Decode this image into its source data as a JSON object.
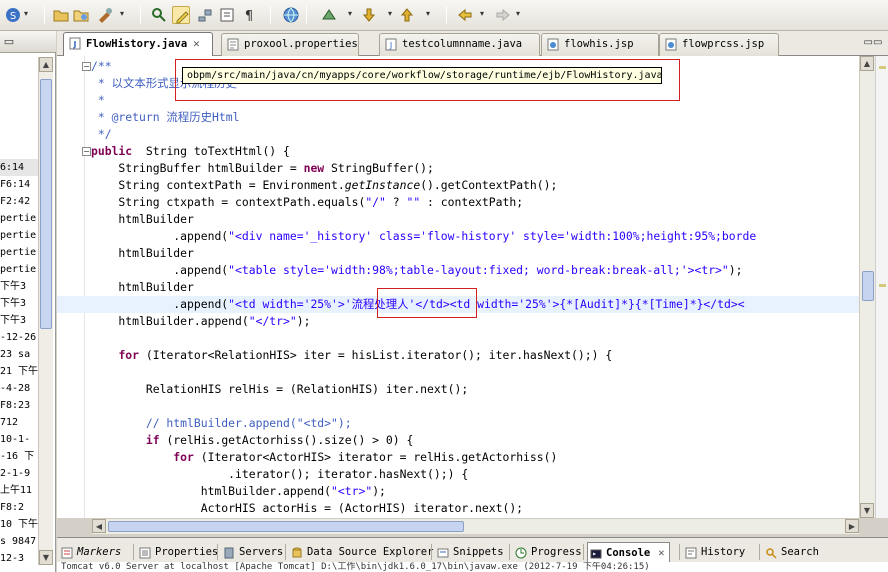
{
  "toolbar": {
    "icons": [
      "save-icon",
      "dropdown",
      "folder-open-icon",
      "open-type-icon",
      "build-icon",
      "dropdown",
      "toggle-mark-occurrences-icon",
      "highlight-icon",
      "link-icon",
      "block-selection-icon",
      "show-whitespace-icon",
      "globe-icon",
      "debug-icon",
      "dropdown",
      "next-annotation-icon",
      "dropdown",
      "prev-annotation-icon",
      "dropdown",
      "back-icon",
      "dropdown",
      "forward-icon",
      "dropdown"
    ]
  },
  "left": {
    "rows": [
      "6:14",
      "F6:14",
      "F2:42",
      "pertie",
      "pertie",
      "pertie",
      "pertie",
      "下午3",
      "下午3",
      "下午3",
      "-12-26",
      "23  sa",
      "21 下午",
      "-4-28",
      "F8:23",
      "712",
      "10-1-",
      "-16 下",
      "2-1-9",
      "上午11",
      "F8:2",
      "10 下午",
      "s 9847",
      "12-3"
    ]
  },
  "tabs": [
    {
      "label": "FlowHistory.java",
      "active": true,
      "icon": "java"
    },
    {
      "label": "proxool.properties",
      "active": false,
      "icon": "props"
    },
    {
      "label": "testcolumnname.java",
      "active": false,
      "icon": "java"
    },
    {
      "label": "flowhis.jsp",
      "active": false,
      "icon": "jsp"
    },
    {
      "label": "flowprcss.jsp",
      "active": false,
      "icon": "jsp"
    }
  ],
  "tooltip": "obpm/src/main/java/cn/myapps/core/workflow/storage/runtime/ejb/FlowHistory.java",
  "code": [
    [
      [
        "cm",
        "/**"
      ]
    ],
    [
      [
        "cm",
        " * 以文本形式显示流程历史"
      ]
    ],
    [
      [
        "cm",
        " *"
      ]
    ],
    [
      [
        "cm",
        " * @return 流程历史Html"
      ]
    ],
    [
      [
        "cm",
        " */"
      ]
    ],
    [
      [
        "kw",
        "public"
      ],
      [
        "",
        "  String toTextHtml() {"
      ]
    ],
    [
      [
        "",
        "    StringBuffer htmlBuilder = "
      ],
      [
        "kw",
        "new"
      ],
      [
        "",
        " StringBuffer();"
      ]
    ],
    [
      [
        "",
        "    String contextPath = Environment."
      ],
      [
        "it",
        "getInstance"
      ],
      [
        "",
        "().getContextPath();"
      ]
    ],
    [
      [
        "",
        "    String ctxpath = contextPath.equals("
      ],
      [
        "st",
        "\"/\""
      ],
      [
        "",
        " ? "
      ],
      [
        "st",
        "\"\""
      ],
      [
        "",
        " : contextPath;"
      ]
    ],
    [
      [
        "",
        "    htmlBuilder"
      ]
    ],
    [
      [
        "",
        "            .append("
      ],
      [
        "st",
        "\"<div name='_history' class='flow-history' style='width:100%;height:95%;borde"
      ]
    ],
    [
      [
        "",
        "    htmlBuilder"
      ]
    ],
    [
      [
        "",
        "            .append("
      ],
      [
        "st",
        "\"<table style='width:98%;table-layout:fixed; word-break:break-all;'><tr>\""
      ],
      [
        "",
        ");"
      ]
    ],
    [
      [
        "",
        "    htmlBuilder"
      ]
    ],
    [
      [
        "",
        "            .append("
      ],
      [
        "st",
        "\"<td width='25%'>'流程处理人'</td><td width='25%'>{*[Audit]*}{*[Time]*}</td><"
      ]
    ],
    [
      [
        "",
        "    htmlBuilder.append("
      ],
      [
        "st",
        "\"</tr>\""
      ],
      [
        "",
        ");"
      ]
    ],
    [
      [
        "",
        ""
      ]
    ],
    [
      [
        "",
        "    "
      ],
      [
        "kw",
        "for"
      ],
      [
        "",
        " (Iterator<RelationHIS> iter = hisList.iterator(); iter.hasNext();) {"
      ]
    ],
    [
      [
        "",
        ""
      ]
    ],
    [
      [
        "",
        "        RelationHIS relHis = (RelationHIS) iter.next();"
      ]
    ],
    [
      [
        "",
        ""
      ]
    ],
    [
      [
        "cm",
        "        // htmlBuilder.append(\"<td>\");"
      ]
    ],
    [
      [
        "",
        "        "
      ],
      [
        "kw",
        "if"
      ],
      [
        "",
        " (relHis.getActorhiss().size() > 0) {"
      ]
    ],
    [
      [
        "",
        "            "
      ],
      [
        "kw",
        "for"
      ],
      [
        "",
        " (Iterator<ActorHIS> iterator = relHis.getActorhiss()"
      ]
    ],
    [
      [
        "",
        "                    .iterator(); iterator.hasNext();) {"
      ]
    ],
    [
      [
        "",
        "                htmlBuilder.append("
      ],
      [
        "st",
        "\"<tr>\""
      ],
      [
        "",
        ");"
      ]
    ],
    [
      [
        "",
        "                ActorHIS actorHis = (ActorHIS) iterator.next();"
      ]
    ]
  ],
  "bottom_tabs": [
    {
      "label": "Markers",
      "italic": true
    },
    {
      "label": "Properties",
      "italic": false
    },
    {
      "label": "Servers",
      "italic": false
    },
    {
      "label": "Data Source Explorer",
      "italic": false
    },
    {
      "label": "Snippets",
      "italic": false
    },
    {
      "label": "Progress",
      "italic": false
    },
    {
      "label": "Console",
      "italic": false,
      "active": true
    },
    {
      "label": "History",
      "italic": false
    },
    {
      "label": "Search",
      "italic": false
    }
  ],
  "console_text": "Tomcat v6.0 Server at localhost [Apache Tomcat] D:\\工作\\bin\\jdk1.6.0_17\\bin\\javaw.exe (2012-7-19 下午04:26:15)"
}
